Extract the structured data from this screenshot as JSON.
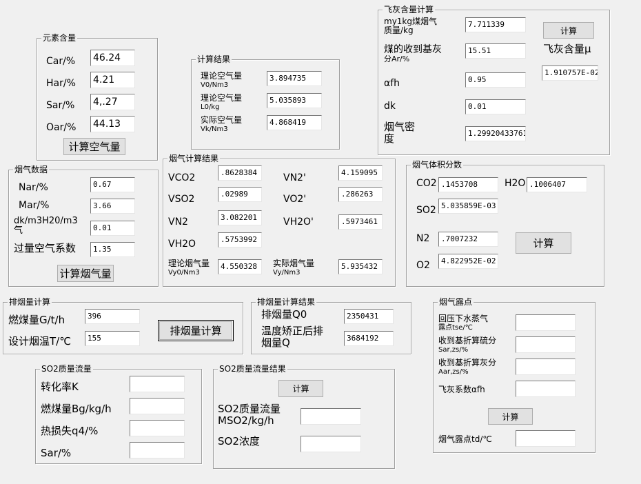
{
  "elements": {
    "title": "元素含量",
    "rows": [
      {
        "label": "Car/%",
        "value": "46.24"
      },
      {
        "label": "Har/%",
        "value": "4.21"
      },
      {
        "label": "Sar/%",
        "value": "4,.27"
      },
      {
        "label": "Oar/%",
        "value": "44.13"
      }
    ],
    "button": "计算空气量"
  },
  "calc_result": {
    "title": "计算结果",
    "rows": [
      {
        "label1": "理论空气量",
        "label2": "V0/Nm3",
        "value": "3.894735"
      },
      {
        "label1": "理论空气量",
        "label2": "L0/kg",
        "value": "5.035893"
      },
      {
        "label1": "实际空气量",
        "label2": "Vk/Nm3",
        "value": "4.868419"
      }
    ]
  },
  "fly_ash": {
    "title": "飞灰含量计算",
    "my_label1": "my1kg煤烟气",
    "my_label2": "质量/kg",
    "my_value": "7.711339",
    "aar_label1": "煤的收到基灰",
    "aar_label2": "分Ar/%",
    "aar_value": "15.51",
    "afh_label": "αfh",
    "afh_value": "0.95",
    "dk_label": "dk",
    "dk_value": "0.01",
    "density_label1": "烟气密",
    "density_label2": "度",
    "density_value": "1.299204337611",
    "button": "计算",
    "result_label": "飞灰含量μ",
    "result_value": "1.910757E-02"
  },
  "flue_data": {
    "title": "烟气数据",
    "nar_label": "Nar/%",
    "nar_value": "0.67",
    "mar_label": "Mar/%",
    "mar_value": "3.66",
    "dk_label1": "dk/m3H20/m3",
    "dk_label2": "气",
    "dk_value": "0.01",
    "excess_label": "过量空气系数",
    "excess_value": "1.35",
    "button": "计算烟气量"
  },
  "flue_result": {
    "title": "烟气计算结果",
    "vco2_label": "VCO2",
    "vco2_value": ".8628384",
    "vn2p_label": "VN2'",
    "vn2p_value": "4.159095",
    "vso2_label": "VSO2",
    "vso2_value": ".02989",
    "vo2p_label": "VO2'",
    "vo2p_value": ".286263",
    "vn2_label": "VN2",
    "vn2_value": "3.082201",
    "vh2op_label": "VH2O'",
    "vh2op_value": ".5973461",
    "vh2o_label": "VH2O",
    "vh2o_value": ".5753992",
    "vy0_label1": "理论烟气量",
    "vy0_label2": "Vy0/Nm3",
    "vy0_value": "4.550328",
    "vy_label1": "实际烟气量",
    "vy_label2": "Vy/Nm3",
    "vy_value": "5.935432"
  },
  "volume_fraction": {
    "title": "烟气体积分数",
    "co2_label": "CO2",
    "co2_value": ".1453708",
    "h2o_label": "H2O",
    "h2o_value": ".1006407",
    "so2_label": "SO2",
    "so2_value": "5.035859E-03",
    "n2_label": "N2",
    "n2_value": ".7007232",
    "o2_label": "O2",
    "o2_value": "4.822952E-02",
    "button": "计算"
  },
  "exhaust": {
    "title": "排烟量计算",
    "coal_label": "燃煤量G/t/h",
    "coal_value": "396",
    "temp_label": "设计烟温T/℃",
    "temp_value": "155",
    "button": "排烟量计算"
  },
  "exhaust_result": {
    "title": "排烟量计算结果",
    "q0_label": "排烟量Q0",
    "q0_value": "2350431",
    "q_label1": "温度矫正后排",
    "q_label2": "烟量Q",
    "q_value": "3684192"
  },
  "dew_point": {
    "title": "烟气露点",
    "tse_label1": "回压下水蒸气",
    "tse_label2": "露点tse/℃",
    "tse_value": "",
    "szs_label1": "收到基折算硫分",
    "szs_label2": "Sar,zs/%",
    "szs_value": "",
    "azs_label1": "收到基折算灰分",
    "azs_label2": "Aar,zs/%",
    "azs_value": "",
    "afh_label": "飞灰系数αfh",
    "afh_value": "",
    "button": "计算",
    "td_label": "烟气露点td/℃",
    "td_value": ""
  },
  "so2_flow": {
    "title": "SO2质量流量",
    "k_label": "转化率K",
    "k_value": "",
    "bg_label": "燃煤量Bg/kg/h",
    "bg_value": "",
    "q4_label": "热损失q4/%",
    "q4_value": "",
    "sar_label": "Sar/%",
    "sar_value": ""
  },
  "so2_result": {
    "title": "SO2质量流量结果",
    "button": "计算",
    "ms_label1": "SO2质量流量",
    "ms_label2": "MSO2/kg/h",
    "ms_value": "",
    "conc_label": "SO2浓度",
    "conc_value": ""
  }
}
